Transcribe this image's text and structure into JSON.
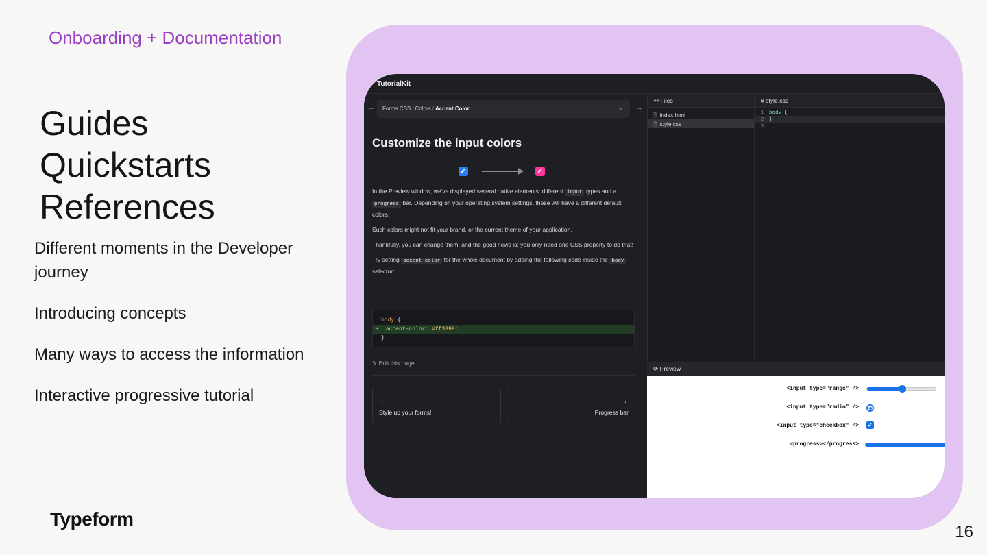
{
  "slide": {
    "kicker": "Onboarding + Documentation",
    "headings": [
      "Guides",
      "Quickstarts",
      "References"
    ],
    "bullets": [
      "Different moments in the Developer journey",
      "Introducing concepts",
      "Many ways to access the information",
      "Interactive progressive tutorial"
    ],
    "brand": "Typeform",
    "page_number": "16",
    "colors": {
      "kicker": "#9b3fc4",
      "frame": "#e2c4f2"
    }
  },
  "app": {
    "name": "TutorialKit",
    "breadcrumb": {
      "part1": "Forms CSS",
      "sep": "/",
      "part2": "Colors",
      "current": "Accent Color"
    },
    "back_arrow": "←",
    "forward_arrow": "→",
    "chevron": "⌄",
    "lesson": {
      "title": "Customize the input colors",
      "p1_a": "In the Preview window, we've displayed several native elements: different ",
      "p1_code1": "input",
      "p1_b": " types and a ",
      "p1_code2": "progress",
      "p1_c": " bar. Depending on your operating system settings, these will have a different default colors.",
      "p2": "Such colors might not fit your brand, or the current theme of your application.",
      "p3": "Thankfully, you can change them, and the good news is: you only need one CSS property to do that!",
      "p4_a": "Try setting ",
      "p4_code1": "accent-color",
      "p4_b": " for the whole document by adding the following code inside the ",
      "p4_code2": "body",
      "p4_c": " selector:",
      "code": {
        "l1_sel": "body",
        "l1_brace": " {",
        "l2_plus": "+",
        "l2_prop": "accent-color:",
        "l2_val": " #ff3399",
        "l2_semi": ";",
        "l3": "}"
      },
      "edit_icon": "✎",
      "edit_label": "Edit this page",
      "prev_icon": "←",
      "prev_label": "Style up your forms!",
      "next_icon": "→",
      "next_label": "Progress bar"
    },
    "files_panel": {
      "icon": "⚯",
      "title": "Files",
      "file_icon": "🗎",
      "files": [
        "index.html",
        "style.css"
      ],
      "active_index": 1
    },
    "editor": {
      "hash": "#",
      "tab": "style.css",
      "line_numbers": [
        "1",
        "2",
        "3"
      ],
      "l1_sel": "body",
      "l1_brace": " {",
      "l2": "}"
    },
    "preview": {
      "icon": "⟳",
      "title": "Preview",
      "rows": [
        "<input type=\"range\" />",
        "<input type=\"radio\" />",
        "<input type=\"checkbox\" />",
        "<progress></progress>"
      ],
      "range_value": 0.5,
      "radio_checked": true,
      "checkbox_checked": true,
      "checkmark": "✓"
    },
    "colors": {
      "accent_before": "#2f7df6",
      "accent_after": "#ff3399",
      "preview_accent": "#1a73e8"
    }
  }
}
